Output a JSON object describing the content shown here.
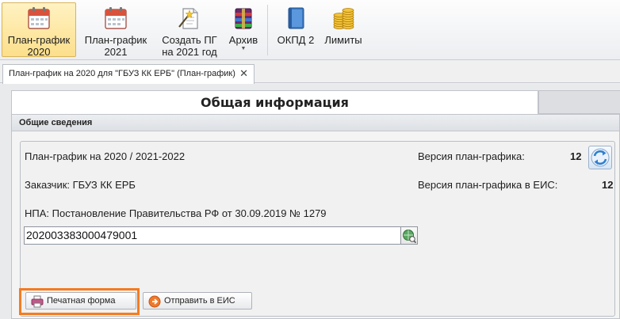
{
  "ribbon": {
    "buttons": [
      {
        "line1": "План-график",
        "line2": "2020",
        "icon": "calendar-icon",
        "active": true
      },
      {
        "line1": "План-график",
        "line2": "2021",
        "icon": "calendar-icon",
        "active": false
      },
      {
        "line1": "Создать ПГ",
        "line2": "на 2021 год",
        "icon": "new-document-wand-icon",
        "active": false
      },
      {
        "line1": "Архив",
        "line2": "",
        "icon": "archive-box-icon",
        "active": false
      },
      {
        "line1": "ОКПД 2",
        "line2": "",
        "icon": "book-icon",
        "active": false
      },
      {
        "line1": "Лимиты",
        "line2": "",
        "icon": "coins-icon",
        "active": false
      }
    ],
    "archive_dropdown_glyph": "▼"
  },
  "doc_tab": {
    "title": "План-график на 2020 для \"ГБУЗ КК ЕРБ\" (План-график)",
    "close": "✕"
  },
  "section": {
    "title": "Общая информация",
    "group_title": "Общие сведения"
  },
  "info": {
    "plan_title": "План-график на 2020 / 2021-2022",
    "customer": "Заказчик: ГБУЗ КК ЕРБ",
    "npa": "НПА: Постановление Правительства РФ от 30.09.2019 № 1279",
    "version_label": "Версия план-графика:",
    "version_value": "12",
    "eis_version_label": "Версия план-графика в ЕИС:",
    "eis_version_value": "12",
    "number_value": "202003383000479001"
  },
  "actions": {
    "print_label": "Печатная форма",
    "send_label": "Отправить в ЕИС"
  },
  "colors": {
    "active_ribbon": "#fcdf8b",
    "highlight": "#f47c20",
    "send_icon": "#f07a2a",
    "print_icon": "#c25a8a"
  }
}
